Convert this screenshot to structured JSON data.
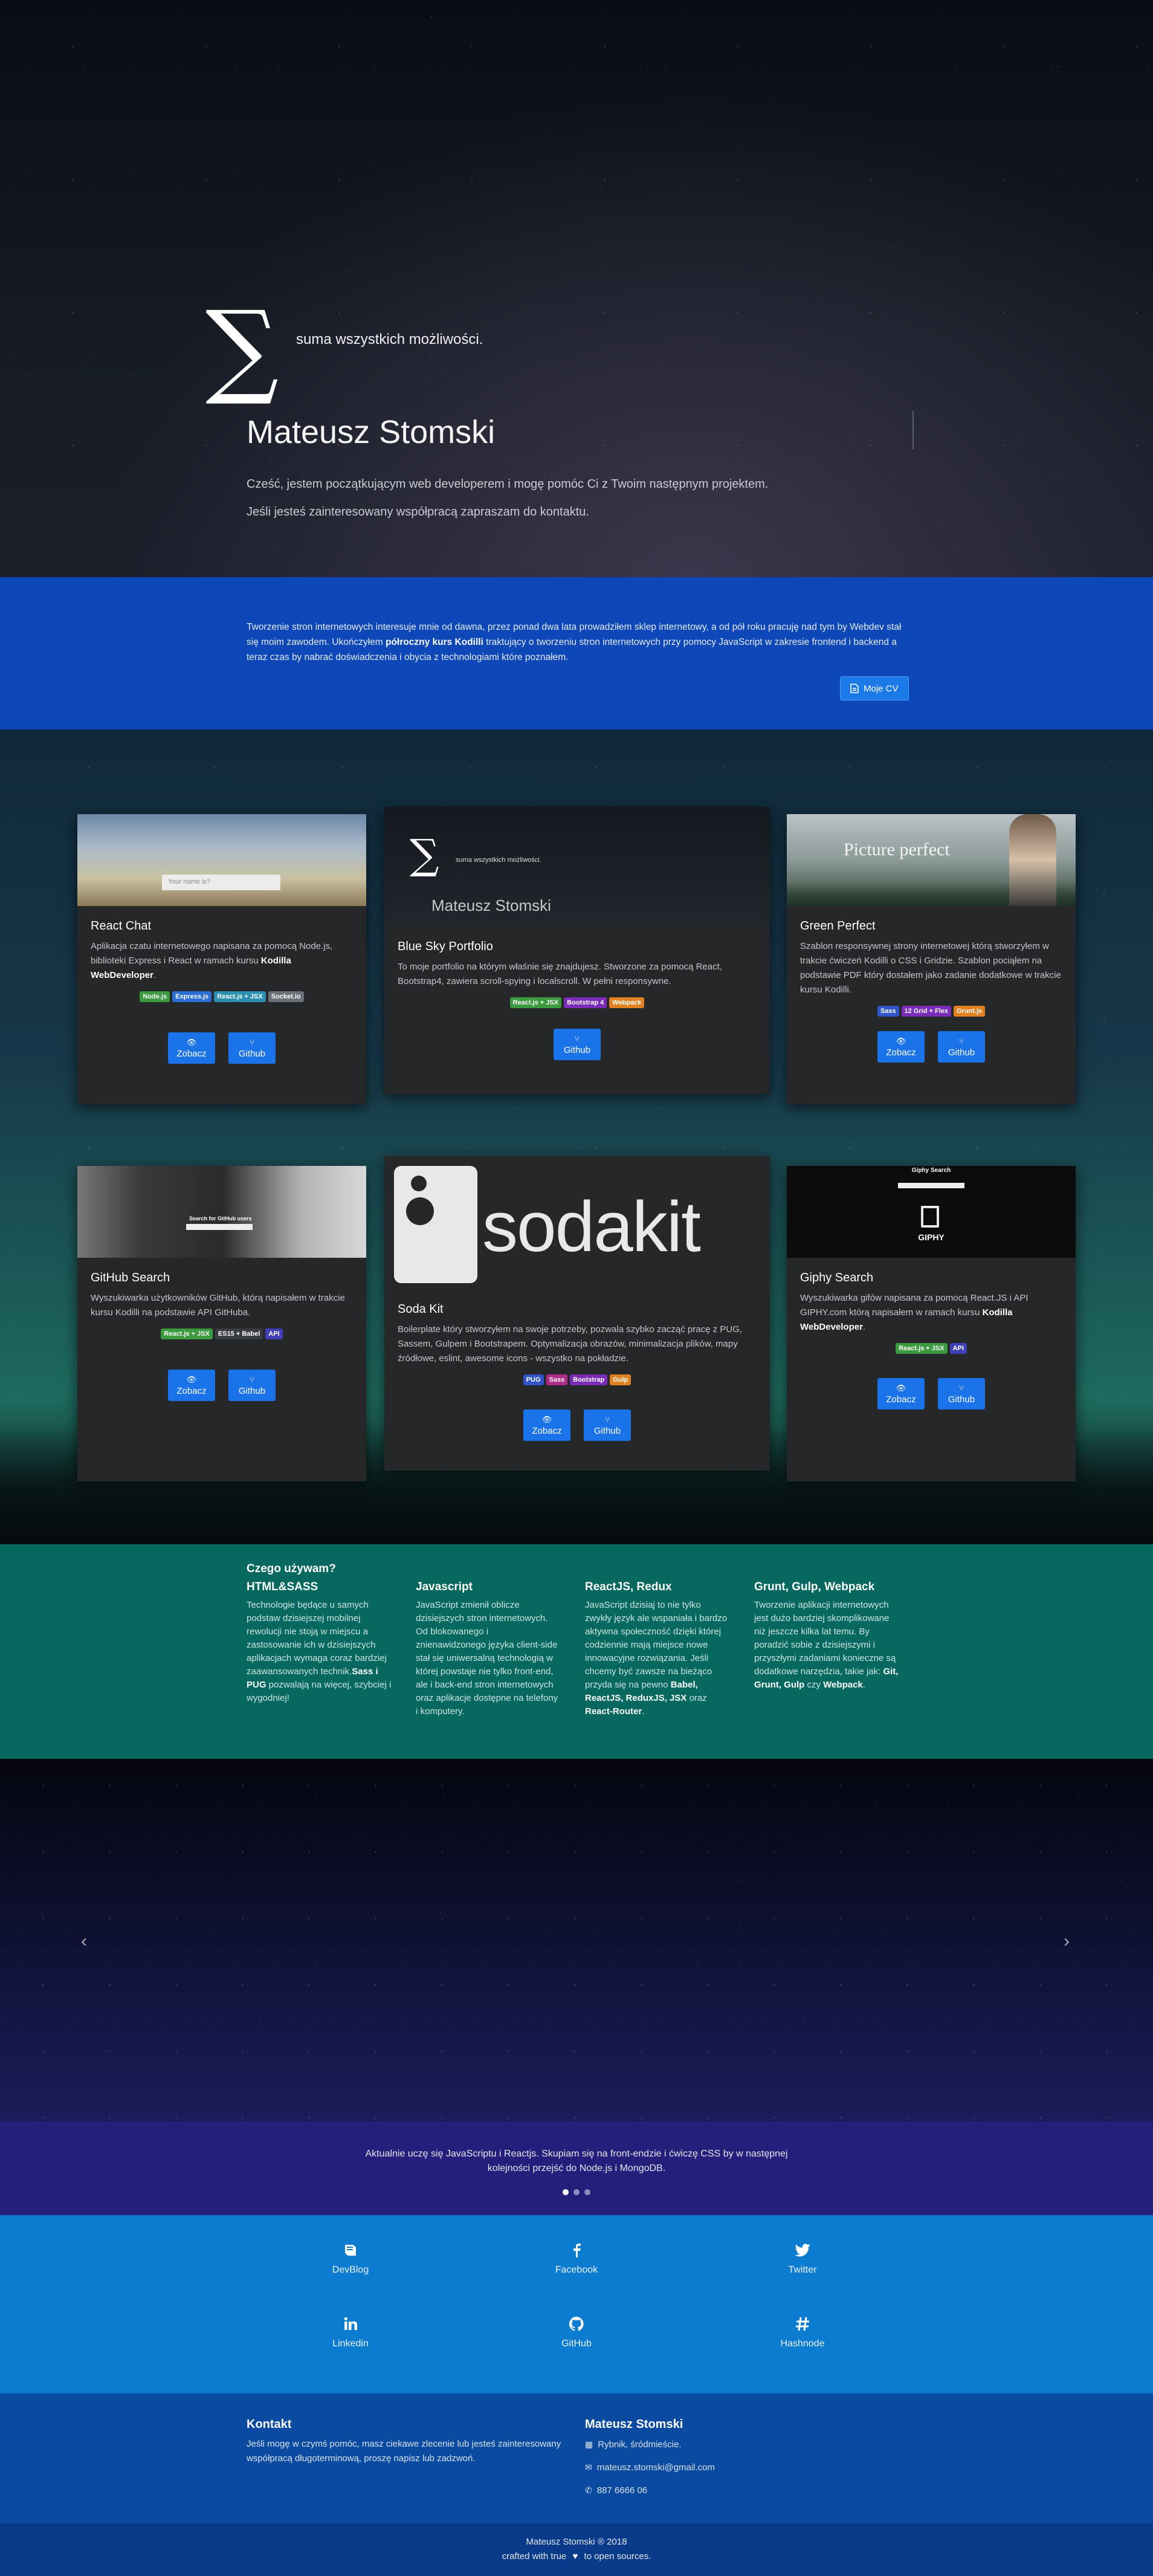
{
  "hero": {
    "logo_symbol": "∑",
    "tagline": "suma wszystkich możliwości.",
    "name": "Mateusz Stomski",
    "intro_1": "Cześć, jestem początkującym web developerem i mogę pomóc Ci z Twoim następnym projektem.",
    "intro_2": "Jeśli jesteś zainteresowany współpracą zapraszam do kontaktu."
  },
  "about": {
    "text_1": "Tworzenie stron internetowych interesuje mnie od dawna, przez ponad dwa lata prowadziłem sklep internetowy, a od pół roku pracuję nad tym by Webdev stał się moim zawodem. Ukończyłem ",
    "text_bold": "półroczny kurs Kodilli",
    "text_2": " traktujący o tworzeniu stron internetowych przy pomocy JavaScript w zakresie frontend i backend a teraz czas by nabrać doświadczenia i obycia z technologiami które poznałem.",
    "cv_button": "Moje CV"
  },
  "projects": {
    "view_label": "Zobacz",
    "github_label": "Github",
    "cards": [
      {
        "title": "React Chat",
        "desc_1": "Aplikacja czatu internetowego napisana za pomocą Node.js, biblioteki Express i React w ramach kursu ",
        "desc_bold": "Kodilla WebDeveloper",
        "desc_2": ".",
        "image_placeholder": "Your name is?",
        "tags": [
          {
            "label": "Node.js",
            "color": "#3a9a3d"
          },
          {
            "label": "Express.js",
            "color": "#2a6fd6"
          },
          {
            "label": "React.js + JSX",
            "color": "#2a8fb0"
          },
          {
            "label": "Socket.io",
            "color": "#6b6f78"
          }
        ]
      },
      {
        "title": "Blue Sky Portfolio",
        "desc_1": "To moje portfolio na którym właśnie się znajdujesz. Stworzone za pomocą React, Bootstrap4, zawiera scroll-spying i localscroll. W pełni responsywne.",
        "desc_bold": "",
        "desc_2": "",
        "image_symbol": "∑",
        "image_tagline": "suma wszystkich możliwości.",
        "image_name": "Mateusz Stomski",
        "tags": [
          {
            "label": "React.js + JSX",
            "color": "#3a9a3d"
          },
          {
            "label": "Bootstrap 4",
            "color": "#7a2bb8"
          },
          {
            "label": "Webpack",
            "color": "#e0801e"
          }
        ]
      },
      {
        "title": "Green Perfect",
        "desc_1": "Szablon responsywnej strony internetowej którą stworzyłem w trakcie ćwiczeń Kodilli o CSS i Gridzie. Szablon pociąłem na podstawie PDF który dostałem jako zadanie dodatkowe w trakcie kursu Kodilli.",
        "desc_bold": "",
        "desc_2": "",
        "image_title": "Picture perfect",
        "tags": [
          {
            "label": "Sass",
            "color": "#2f55c8"
          },
          {
            "label": "12 Grid + Flex",
            "color": "#7a2bb8"
          },
          {
            "label": "Grunt.js",
            "color": "#e0801e"
          }
        ]
      },
      {
        "title": "GitHub Search",
        "desc_1": "Wyszukiwarka użytkowników GitHub, którą napisałem w trakcie kursu Kodilli na podstawie API GitHuba.",
        "desc_bold": "",
        "desc_2": "",
        "image_caption": "Search for GitHub users",
        "tags": [
          {
            "label": "React.js + JSX",
            "color": "#3a9a3d"
          },
          {
            "label": "ES15 + Babel",
            "color": "#3a3c44"
          },
          {
            "label": "API",
            "color": "#3f3fb8"
          }
        ]
      },
      {
        "title": "Soda Kit",
        "desc_1": "Boilerplate który stworzyłem na swoje potrzeby, pozwala szybko zacząć pracę z PUG, Sassem, Gulpem i Bootstrapem. Optymalizacja obrazów, minimalizacja plików, mapy źródłowe, eslint, awesome icons - wszystko na pokładzie.",
        "desc_bold": "",
        "desc_2": "",
        "image_word": "sodakit",
        "tags": [
          {
            "label": "PUG",
            "color": "#2f55c8"
          },
          {
            "label": "Sass",
            "color": "#b02a8a"
          },
          {
            "label": "Bootstrap",
            "color": "#7a2bb8"
          },
          {
            "label": "Gulp",
            "color": "#e0801e"
          }
        ]
      },
      {
        "title": "Giphy Search",
        "desc_1": "Wyszukiwarka gifów napisana za pomocą React.JS i API GIPHY.com którą napisałem w ramach kursu ",
        "desc_bold": "Kodilla WebDeveloper",
        "desc_2": ".",
        "image_title": "Giphy Search",
        "image_logo": "GIPHY",
        "tags": [
          {
            "label": "React.js + JSX",
            "color": "#3a9a3d"
          },
          {
            "label": "API",
            "color": "#3f3fb8"
          }
        ]
      }
    ]
  },
  "tech": {
    "heading": "Czego używam?",
    "columns": [
      {
        "title": "HTML&SASS",
        "text_1": "Technologie będące u samych podstaw dzisiejszej mobilnej rewolucji nie stoją w miejscu a zastosowanie ich w dzisiejszych aplikacjach wymaga coraz bardziej zaawansowanych technik.",
        "bold_1": "Sass i PUG",
        "text_2": " pozwalają na więcej, szybciej i wygodniej!",
        "bold_2": "",
        "text_3": ""
      },
      {
        "title": "Javascript",
        "text_1": "JavaScript zmienił oblicze dzisiejszych stron internetowych. Od blokowanego i znienawidzonego języka client-side stał się uniwersalną technologią w której powstaje nie tylko front-end, ale i back-end stron internetowych oraz aplikacje dostępne na telefony i komputery.",
        "bold_1": "",
        "text_2": "",
        "bold_2": "",
        "text_3": ""
      },
      {
        "title": "ReactJS, Redux",
        "text_1": "JavaScript dzisiaj to nie tylko zwykły język ale wspaniała i bardzo aktywna społeczność dzięki której codziennie mają miejsce nowe innowacyjne rozwiązania. Jeśli chcemy być zawsze na bieżąco przyda się na pewno ",
        "bold_1": "Babel, ReactJS, ReduxJS, JSX",
        "text_2": " oraz ",
        "bold_2": "React-Router",
        "text_3": "."
      },
      {
        "title": "Grunt, Gulp, Webpack",
        "text_1": "Tworzenie aplikacji internetowych jest dużo bardziej skomplikowane niż jeszcze kilka lat temu. By poradzić sobie z dzisiejszymi i przyszłymi zadaniami konieczne są dodatkowe narzędzia, takie jak: ",
        "bold_1": "Git, Grunt, Gulp",
        "text_2": " czy ",
        "bold_2": "Webpack",
        "text_3": "."
      }
    ]
  },
  "slider": {
    "prev_icon": "‹",
    "next_icon": "›"
  },
  "learning": {
    "line_1": "Aktualnie uczę się JavaScriptu i Reactjs. Skupiam się na front-endzie i ćwiczę CSS by w następnej",
    "line_2": "kolejności przejść do Node.js i MongoDB."
  },
  "social": {
    "items": [
      {
        "label": "DevBlog",
        "icon": "book-icon"
      },
      {
        "label": "Facebook",
        "icon": "facebook-icon"
      },
      {
        "label": "Twitter",
        "icon": "twitter-icon"
      },
      {
        "label": "Linkedin",
        "icon": "linkedin-icon"
      },
      {
        "label": "GitHub",
        "icon": "github-icon"
      },
      {
        "label": "Hashnode",
        "icon": "hashtag-icon"
      }
    ]
  },
  "contact": {
    "heading": "Kontakt",
    "text": "Jeśli mogę w czymś pomóc, masz ciekawe zlecenie lub jesteś zainteresowany współpracą długoterminową, proszę napisz lub zadzwoń.",
    "name": "Mateusz Stomski",
    "address": "Rybnik, śródmieście.",
    "email": "mateusz.stomski@gmail.com",
    "phone": "887 6666 06"
  },
  "footer": {
    "line_1": "Mateusz Stomski ® 2018",
    "line_2_a": "crafted with true",
    "line_2_b": "to open sources."
  },
  "colors": {
    "about_bg": "#0d47b8",
    "tech_bg": "#06685f",
    "learning_bg": "#241f7a",
    "social_bg": "#0b7ccf",
    "contact_bg": "#0a4aa0",
    "footer_bg": "#0a3a8a",
    "button": "#1a73e8",
    "card_bg": "#262729"
  }
}
